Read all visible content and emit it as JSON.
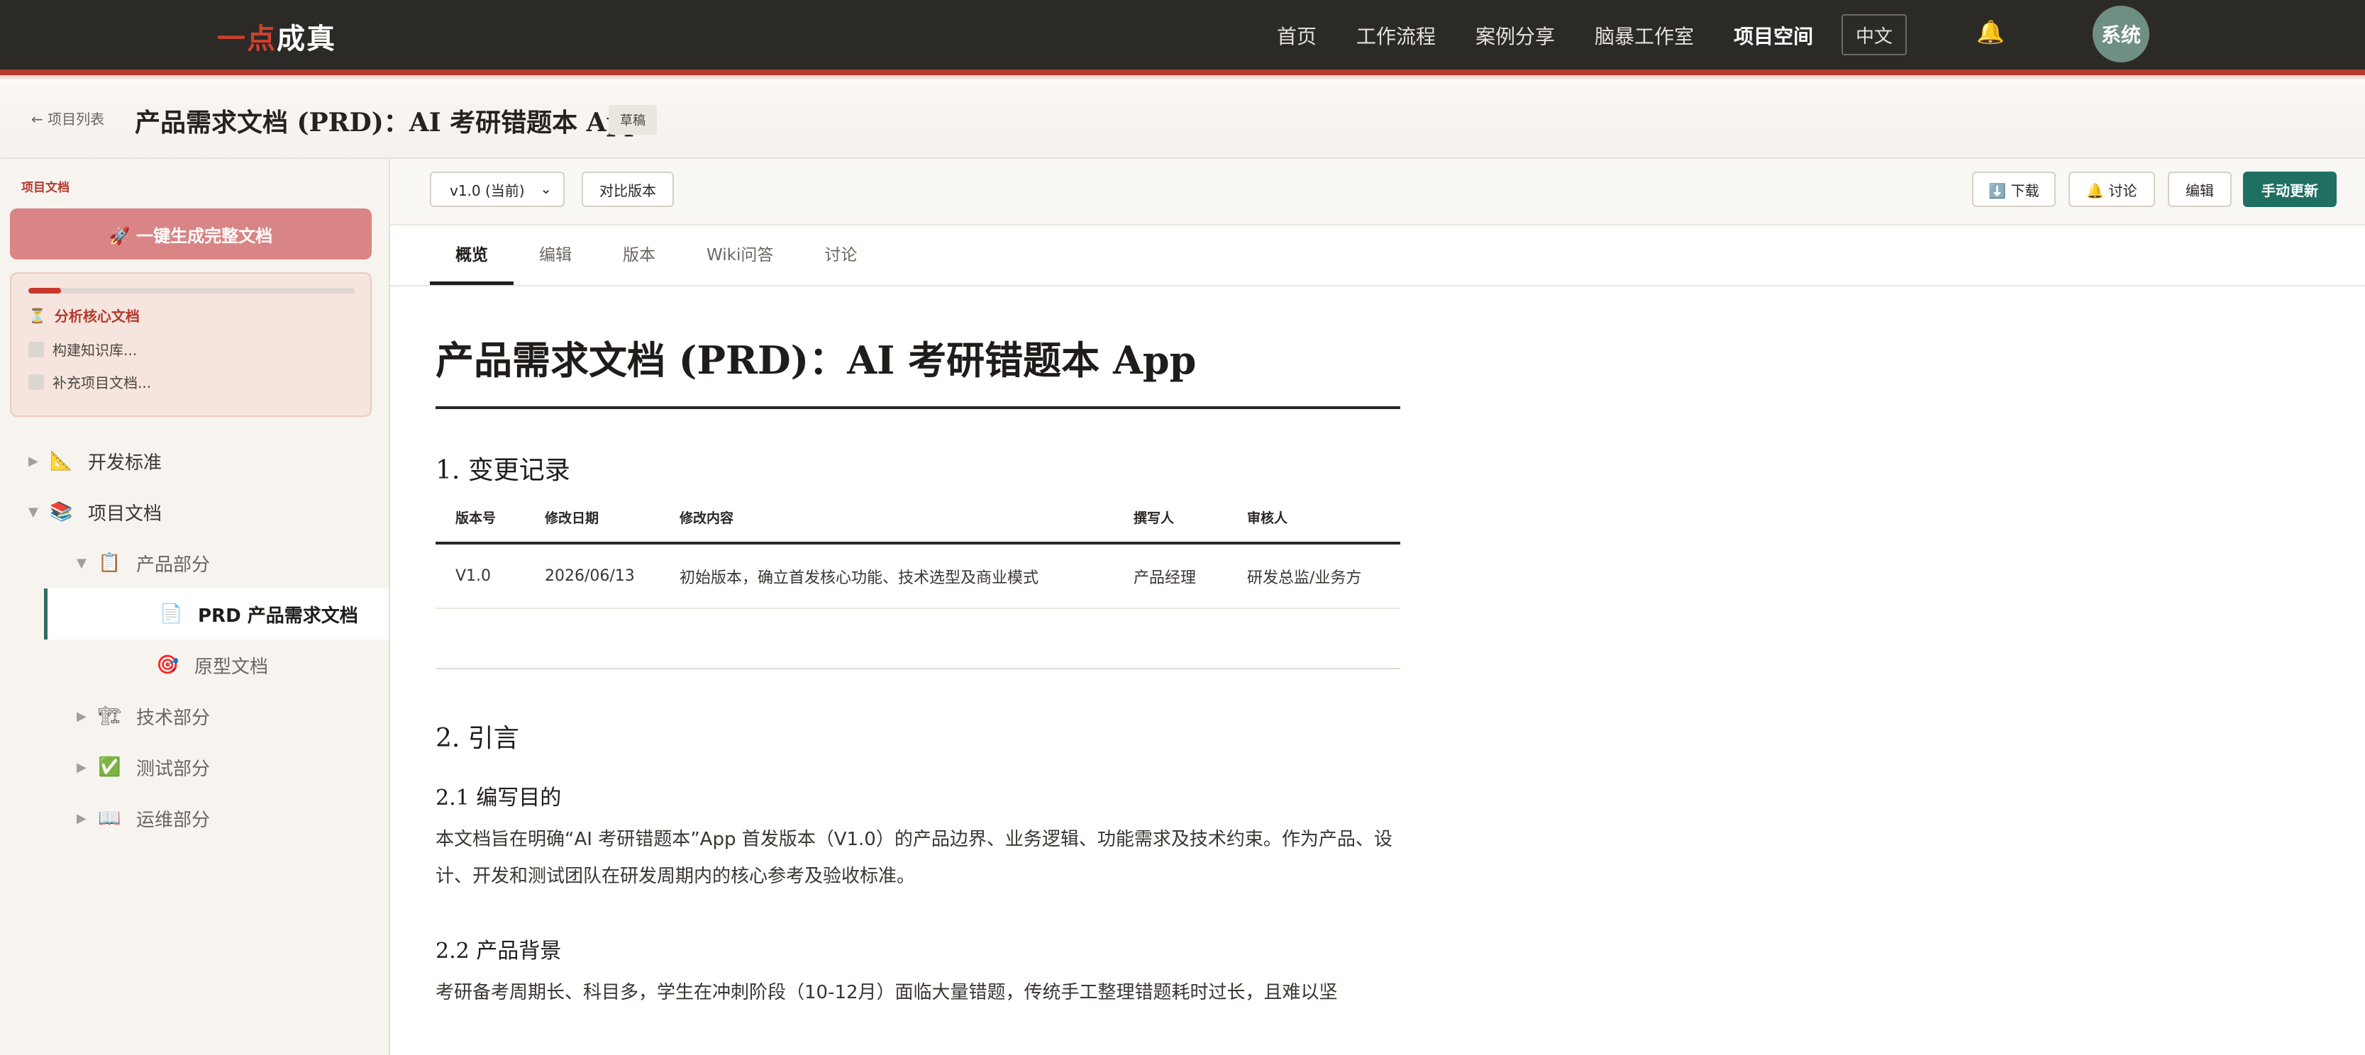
{
  "topbar": {
    "logo_part1": "一点",
    "logo_part2": "成真",
    "nav": [
      "首页",
      "工作流程",
      "案例分享",
      "脑暴工作室",
      "项目空间"
    ],
    "lang": "中文",
    "avatar_text": "系统"
  },
  "subheader": {
    "back_label": "← 项目列表",
    "title": "产品需求文档 (PRD)：AI 考研错题本 App",
    "badge": "草稿"
  },
  "sidebar": {
    "section_label": "项目文档",
    "generate_button": "🚀 一键生成完整文档",
    "progress": 0.1,
    "steps": [
      {
        "icon": "⏳",
        "label": "分析核心文档"
      },
      {
        "label": "构建知识库..."
      },
      {
        "label": "补充项目文档..."
      }
    ],
    "tree": [
      {
        "arrow": "▶",
        "icon": "📐",
        "label": "开发标准"
      },
      {
        "arrow": "▼",
        "icon": "📚",
        "label": "项目文档"
      },
      {
        "arrow": "▼",
        "icon": "📋",
        "label": "产品部分"
      },
      {
        "icon": "📄",
        "label": "PRD 产品需求文档"
      },
      {
        "icon": "🎯",
        "label": "原型文档"
      },
      {
        "arrow": "▶",
        "icon": "🏗",
        "label": "技术部分"
      },
      {
        "arrow": "▶",
        "icon": "✅",
        "label": "测试部分"
      },
      {
        "arrow": "▶",
        "icon": "📖",
        "label": "运维部分"
      }
    ]
  },
  "toolbar": {
    "version": "v1.0 (当前)",
    "compare": "对比版本",
    "download": "⬇️ 下载",
    "discuss": "🔔 讨论",
    "edit": "编辑",
    "manual_update": "手动更新"
  },
  "tabs": [
    "概览",
    "编辑",
    "版本",
    "Wiki问答",
    "讨论"
  ],
  "article": {
    "h1": "产品需求文档 (PRD)：AI 考研错题本 App",
    "sec1": "1. 变更记录",
    "table_headers": [
      "版本号",
      "修改日期",
      "修改内容",
      "撰写人",
      "审核人"
    ],
    "table_rows": [
      [
        "V1.0",
        "2026/06/13",
        "初始版本，确立首发核心功能、技术选型及商业模式",
        "产品经理",
        "研发总监/业务方"
      ]
    ],
    "sec2": "2. 引言",
    "sec2_1": "2.1 编写目的",
    "p1": "本文档旨在明确“AI 考研错题本”App 首发版本（V1.0）的产品边界、业务逻辑、功能需求及技术约束。作为产品、设计、开发和测试团队在研发周期内的核心参考及验收标准。",
    "sec2_2": "2.2 产品背景",
    "p2": "考研备考周期长、科目多，学生在冲刺阶段（10-12月）面临大量错题，传统手工整理错题耗时过长，且难以坚"
  }
}
